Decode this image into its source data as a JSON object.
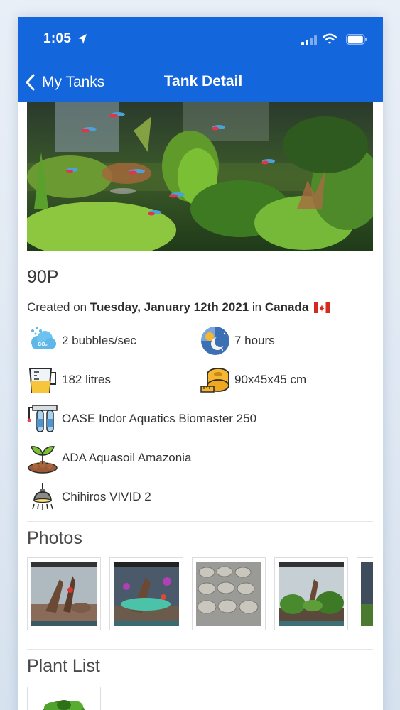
{
  "status_bar": {
    "time": "1:05"
  },
  "nav": {
    "back_label": "My Tanks",
    "title": "Tank Detail"
  },
  "tank": {
    "name": "90P",
    "created_prefix": "Created on ",
    "created_date": "Tuesday, January 12th 2021",
    "created_in": " in ",
    "country": "Canada"
  },
  "stats": {
    "co2": "2 bubbles/sec",
    "light_hours": "7 hours",
    "volume": "182 litres",
    "dimensions": "90x45x45 cm",
    "filter": "OASE Indor Aquatics Biomaster 250",
    "substrate": "ADA Aquasoil Amazonia",
    "light": "Chihiros VIVID 2"
  },
  "icons": {
    "co2": "co2-cloud-icon",
    "light_hours": "day-night-icon",
    "volume": "measuring-jug-icon",
    "dimensions": "tape-measure-icon",
    "filter": "filter-icon",
    "substrate": "soil-sprout-icon",
    "light": "ceiling-lamp-icon"
  },
  "sections": {
    "photos": "Photos",
    "plants": "Plant List"
  },
  "colors": {
    "header": "#1466dc",
    "text": "#333333"
  }
}
